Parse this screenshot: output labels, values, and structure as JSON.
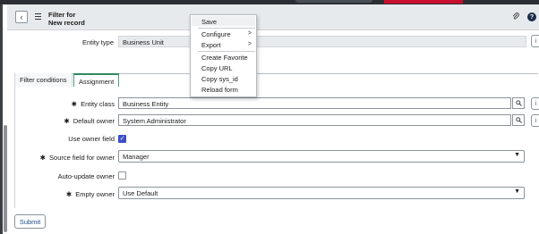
{
  "header": {
    "title_line1": "Filter for",
    "title_line2": "New record",
    "back_icon": "chevron-left-icon",
    "menu_icon": "hamburger-icon",
    "attach_icon": "paperclip-icon",
    "help_label": "?"
  },
  "context_menu": {
    "items": [
      {
        "label": "Save"
      },
      {
        "label": "Configure",
        "arrow": ">"
      },
      {
        "label": "Export",
        "arrow": ">"
      },
      {
        "label": "Create Favorite"
      },
      {
        "label": "Copy URL"
      },
      {
        "label": "Copy sys_id"
      },
      {
        "label": "Reload form"
      }
    ]
  },
  "entity_type": {
    "label": "Entity type",
    "value": "Business Unit"
  },
  "tabs": [
    {
      "label": "Filter conditions",
      "active": false
    },
    {
      "label": "Assignment",
      "active": true
    }
  ],
  "fields": {
    "entity_class": {
      "required_mark": "✱",
      "label": "Entity class",
      "value": "Business Entity"
    },
    "default_owner": {
      "required_mark": "✱",
      "label": "Default owner",
      "value": "System Administrator"
    },
    "use_owner_field": {
      "label": "Use owner field",
      "checked": true
    },
    "source_field": {
      "required_mark": "✱",
      "label": "Source field for owner",
      "value": "Manager"
    },
    "auto_update_owner": {
      "label": "Auto-update owner",
      "checked": false
    },
    "empty_owner": {
      "required_mark": "✱",
      "label": "Empty owner",
      "value": "Use Default"
    }
  },
  "submit_label": "Submit",
  "colors": {
    "checkbox_checked": "#3f4fc7",
    "active_tab": "#2d8a5f",
    "top_alert": "#c8102e"
  }
}
